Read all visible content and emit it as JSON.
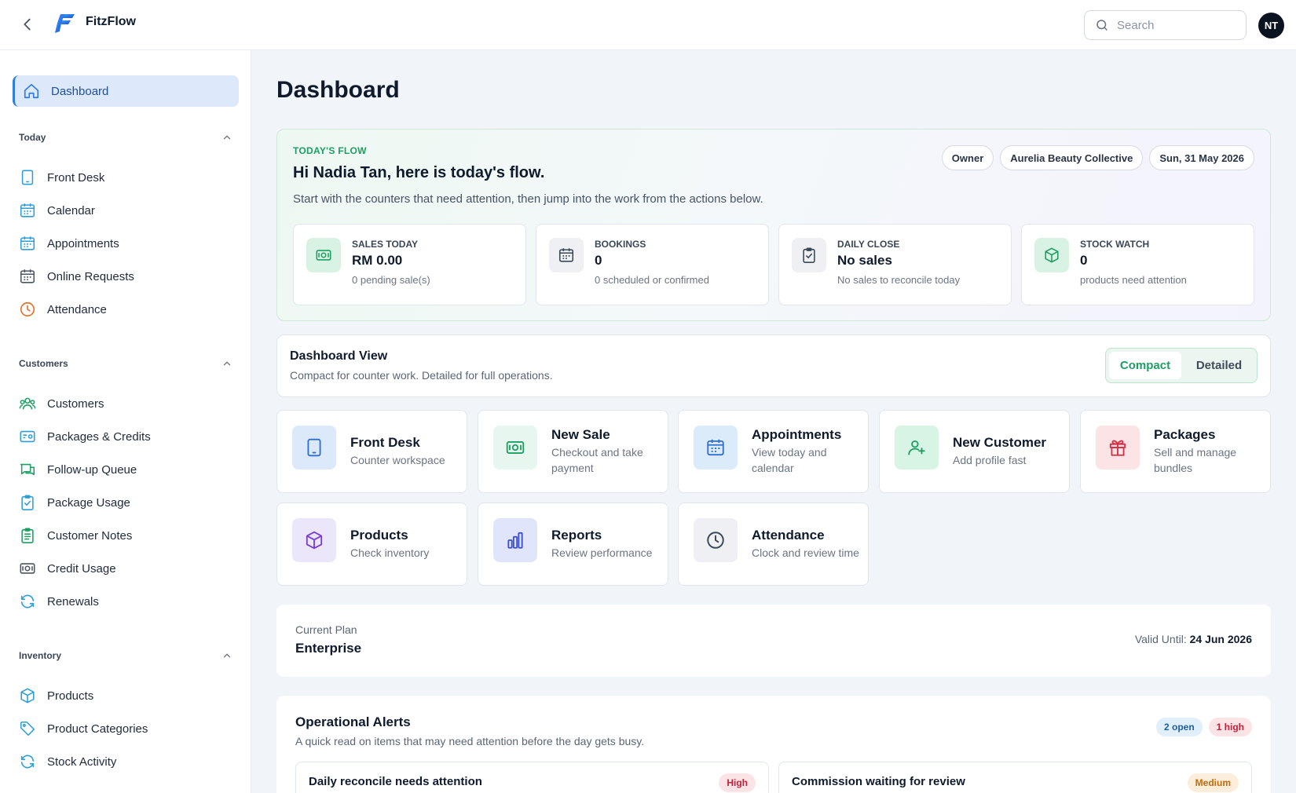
{
  "app": {
    "name": "FitzFlow",
    "user_initials": "NT"
  },
  "search": {
    "placeholder": "Search"
  },
  "sidebar": {
    "active": {
      "label": "Dashboard"
    },
    "sections": [
      {
        "title": "Today",
        "items": [
          {
            "label": "Front Desk",
            "icon": "tablet-icon"
          },
          {
            "label": "Calendar",
            "icon": "calendar-icon"
          },
          {
            "label": "Appointments",
            "icon": "calendar-icon"
          },
          {
            "label": "Online Requests",
            "icon": "calendar-icon"
          },
          {
            "label": "Attendance",
            "icon": "clock-icon"
          }
        ]
      },
      {
        "title": "Customers",
        "items": [
          {
            "label": "Customers",
            "icon": "users-icon"
          },
          {
            "label": "Packages & Credits",
            "icon": "ticket-icon"
          },
          {
            "label": "Follow-up Queue",
            "icon": "chat-icon"
          },
          {
            "label": "Package Usage",
            "icon": "clipboard-check-icon"
          },
          {
            "label": "Customer Notes",
            "icon": "clipboard-list-icon"
          },
          {
            "label": "Credit Usage",
            "icon": "money-icon"
          },
          {
            "label": "Renewals",
            "icon": "refresh-icon"
          }
        ]
      },
      {
        "title": "Inventory",
        "items": [
          {
            "label": "Products",
            "icon": "box-icon"
          },
          {
            "label": "Product Categories",
            "icon": "tag-icon"
          },
          {
            "label": "Stock Activity",
            "icon": "refresh-icon"
          }
        ]
      }
    ]
  },
  "page": {
    "title": "Dashboard"
  },
  "flow": {
    "kicker": "TODAY'S FLOW",
    "greeting": "Hi Nadia Tan, here is today's flow.",
    "subtitle": "Start with the counters that need attention, then jump into the work from the actions below.",
    "chips": [
      "Owner",
      "Aurelia Beauty Collective",
      "Sun, 31 May 2026"
    ],
    "stats": [
      {
        "label": "SALES TODAY",
        "value": "RM 0.00",
        "note": "0 pending sale(s)"
      },
      {
        "label": "BOOKINGS",
        "value": "0",
        "note": "0 scheduled or confirmed"
      },
      {
        "label": "DAILY CLOSE",
        "value": "No sales",
        "note": "No sales to reconcile today"
      },
      {
        "label": "STOCK WATCH",
        "value": "0",
        "note": "products need attention"
      }
    ]
  },
  "view": {
    "title": "Dashboard View",
    "subtitle": "Compact for counter work. Detailed for full operations.",
    "options": [
      "Compact",
      "Detailed"
    ],
    "selected": "Compact"
  },
  "quick_actions": [
    {
      "title": "Front Desk",
      "subtitle": "Counter workspace"
    },
    {
      "title": "New Sale",
      "subtitle": "Checkout and take payment"
    },
    {
      "title": "Appointments",
      "subtitle": "View today and calendar"
    },
    {
      "title": "New Customer",
      "subtitle": "Add profile fast"
    },
    {
      "title": "Packages",
      "subtitle": "Sell and manage bundles"
    },
    {
      "title": "Products",
      "subtitle": "Check inventory"
    },
    {
      "title": "Reports",
      "subtitle": "Review performance"
    },
    {
      "title": "Attendance",
      "subtitle": "Clock and review time"
    }
  ],
  "plan": {
    "label": "Current Plan",
    "value": "Enterprise",
    "valid_label": "Valid Until:",
    "valid_date": "24 Jun 2026"
  },
  "alerts": {
    "title": "Operational Alerts",
    "subtitle": "A quick read on items that may need attention before the day gets busy.",
    "open_badge": "2 open",
    "high_badge": "1 high",
    "items": [
      {
        "title": "Daily reconcile needs attention",
        "severity": "High"
      },
      {
        "title": "Commission waiting for review",
        "severity": "Medium"
      }
    ]
  }
}
